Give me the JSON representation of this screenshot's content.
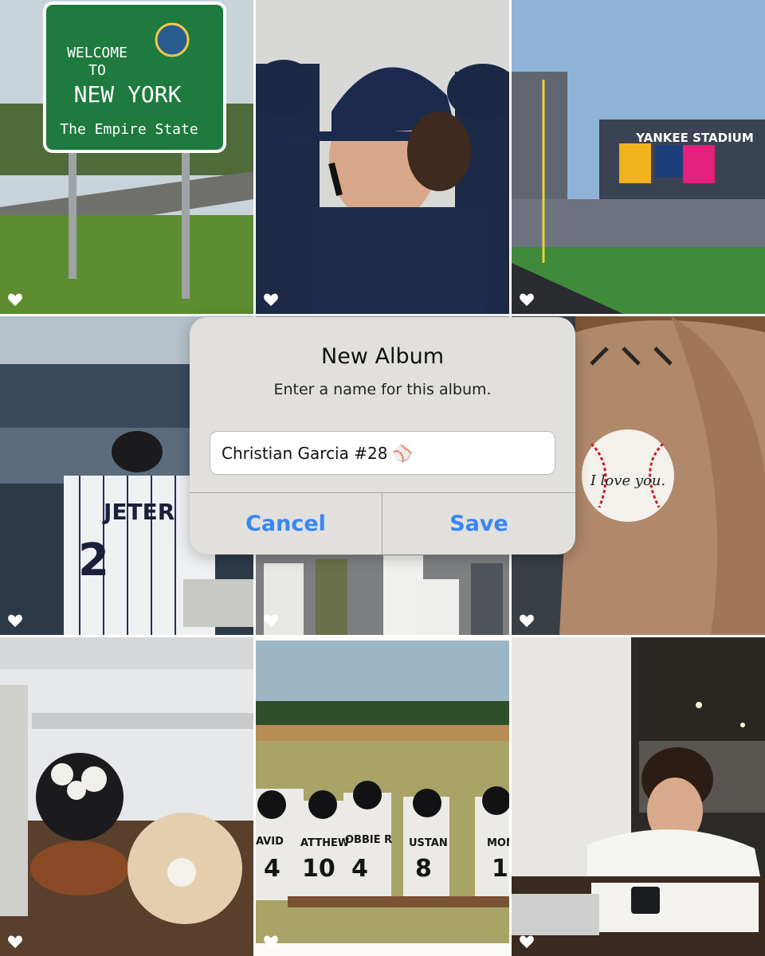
{
  "dialog": {
    "title": "New Album",
    "subtitle": "Enter a name for this album.",
    "field_value": "Christian Garcia #28 ⚾",
    "cancel_label": "Cancel",
    "save_label": "Save"
  },
  "photos": {
    "sign_line1": "WELCOME",
    "sign_line2": "TO",
    "sign_line3": "NEW YORK",
    "sign_line4": "The Empire State",
    "stadium_name": "YANKEE STADIUM",
    "jersey_name": "JETER",
    "jersey_number": "2",
    "ball_text": "I love you.",
    "kid_names": [
      "AVID",
      "ATTHEW",
      "OBBIE R",
      "USTAN",
      "MON"
    ],
    "kid_numbers": [
      "4",
      "10",
      "4",
      "8",
      "1"
    ]
  },
  "colors": {
    "accent": "#3a86f0",
    "dialog_bg": "#e2e0dd",
    "heart": "#ffffff"
  },
  "icons": {
    "favorite": "heart-icon"
  }
}
